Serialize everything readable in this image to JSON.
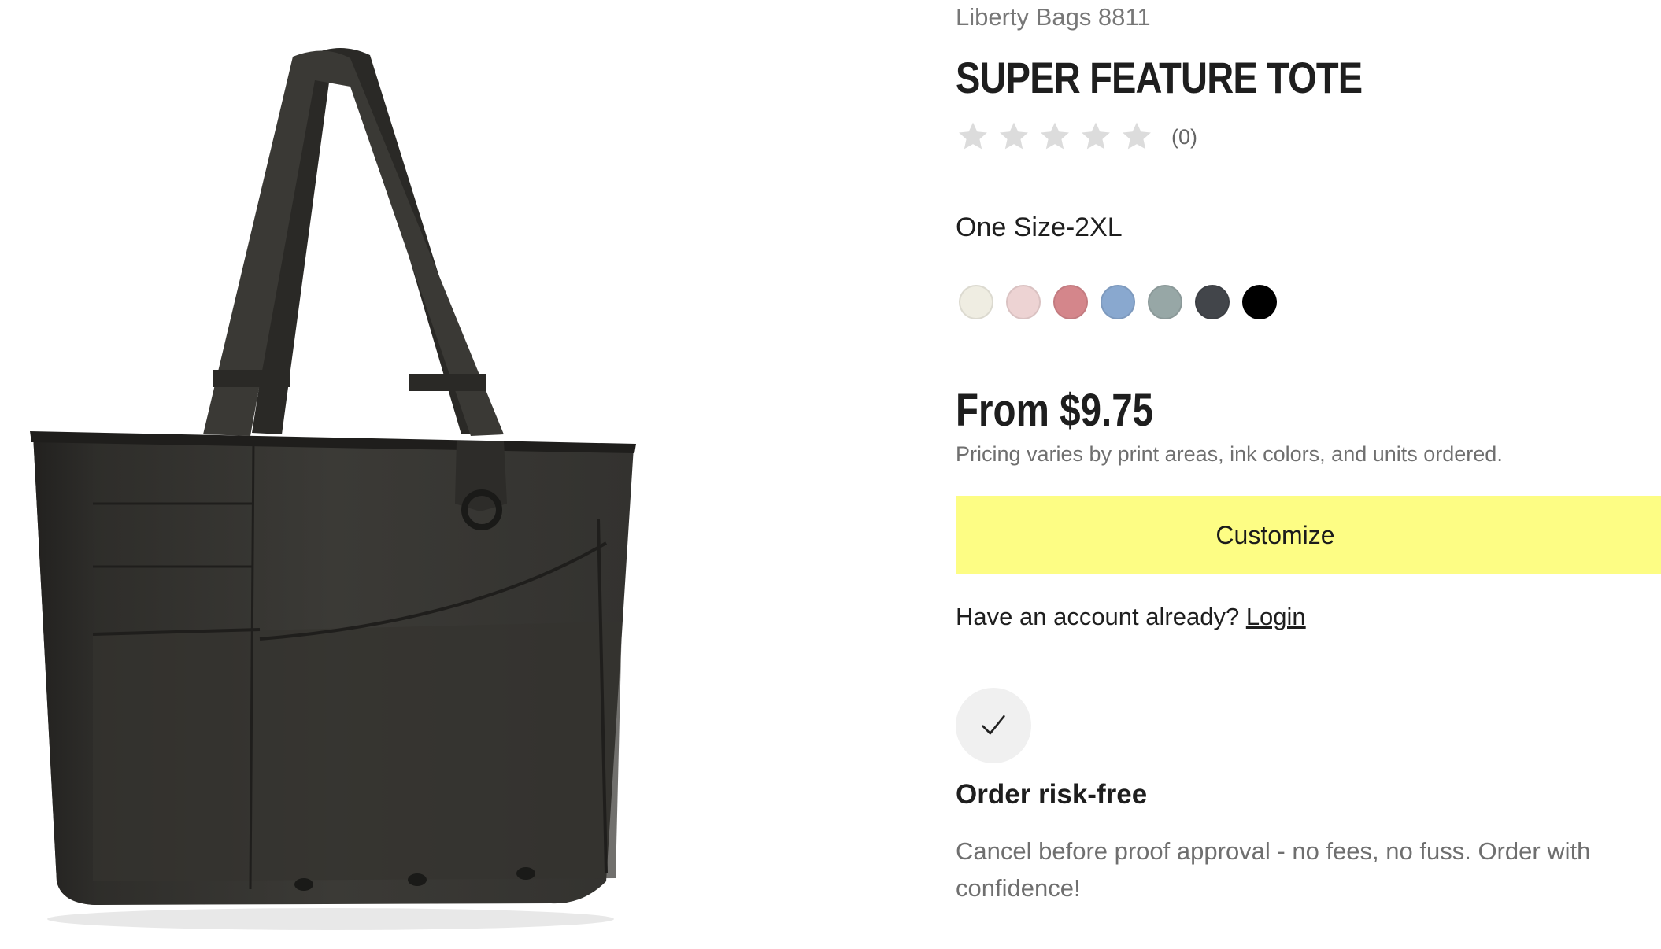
{
  "product": {
    "brand": "Liberty Bags 8811",
    "title": "SUPER FEATURE TOTE",
    "image_alt": "Black tote bag product photo"
  },
  "rating": {
    "stars": 0,
    "max_stars": 5,
    "count_label": "(0)",
    "star_color": "#dcdcdc"
  },
  "size": {
    "label": "One Size-2XL"
  },
  "colors": [
    {
      "name": "natural",
      "hex": "#efede2"
    },
    {
      "name": "light pink",
      "hex": "#edd3d3"
    },
    {
      "name": "mauve",
      "hex": "#d4868b"
    },
    {
      "name": "blue",
      "hex": "#89a8cf"
    },
    {
      "name": "sage",
      "hex": "#97a7a6"
    },
    {
      "name": "charcoal",
      "hex": "#42454a"
    },
    {
      "name": "black",
      "hex": "#000000"
    }
  ],
  "pricing": {
    "price_label": "From $9.75",
    "note": "Pricing varies by print areas, ink colors, and units ordered."
  },
  "actions": {
    "customize_label": "Customize",
    "customize_color": "#fdfd84",
    "account_prompt": "Have an account already?",
    "login_label": "Login"
  },
  "risk_free": {
    "icon": "checkmark-icon",
    "title": "Order risk-free",
    "text": "Cancel before proof approval - no fees, no fuss. Order with confidence!"
  }
}
